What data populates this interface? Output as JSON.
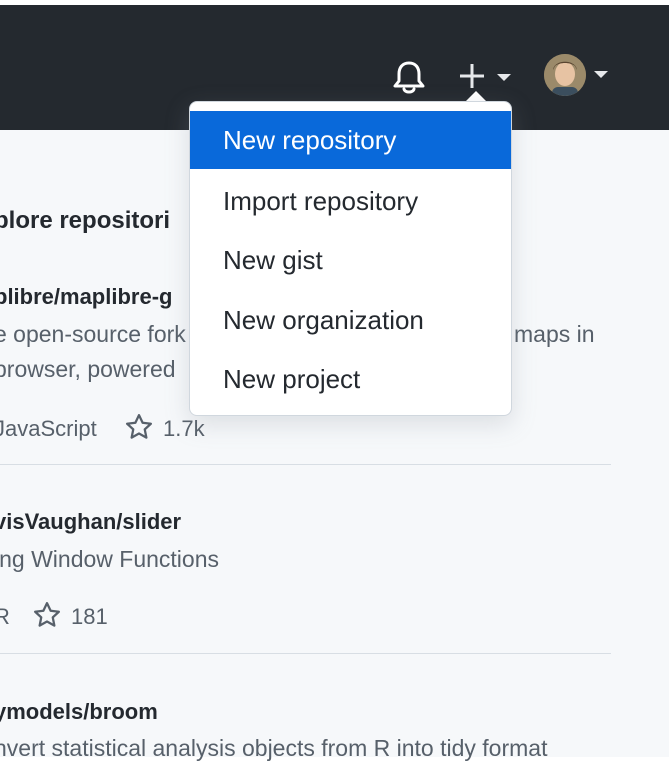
{
  "header": {
    "icons": [
      "bell-icon",
      "plus-icon",
      "caret-down-icon",
      "avatar",
      "caret-down-icon"
    ]
  },
  "create_menu": {
    "items": [
      {
        "label": "New repository",
        "active": true
      },
      {
        "label": "Import repository",
        "active": false
      },
      {
        "label": "New gist",
        "active": false
      },
      {
        "label": "New organization",
        "active": false
      },
      {
        "label": "New project",
        "active": false
      }
    ]
  },
  "explore": {
    "title": "plore repositori",
    "repos": [
      {
        "name": "plibre/maplibre-g",
        "desc_line1": "e open-source fork",
        "desc_line1_end": "maps in",
        "desc_line2": " browser, powered",
        "language": "JavaScript",
        "stars": "1.7k"
      },
      {
        "name": "visVaughan/slider",
        "desc_line1": "ing Window Functions",
        "language": "R",
        "stars": "181"
      },
      {
        "name": "ymodels/broom",
        "desc_line1": "nvert statistical analysis objects from R into tidy format"
      }
    ]
  },
  "colors": {
    "header_bg": "#24292f",
    "page_bg": "#f6f8fa",
    "menu_active_bg": "#0969da",
    "divider": "#d8dee4"
  }
}
